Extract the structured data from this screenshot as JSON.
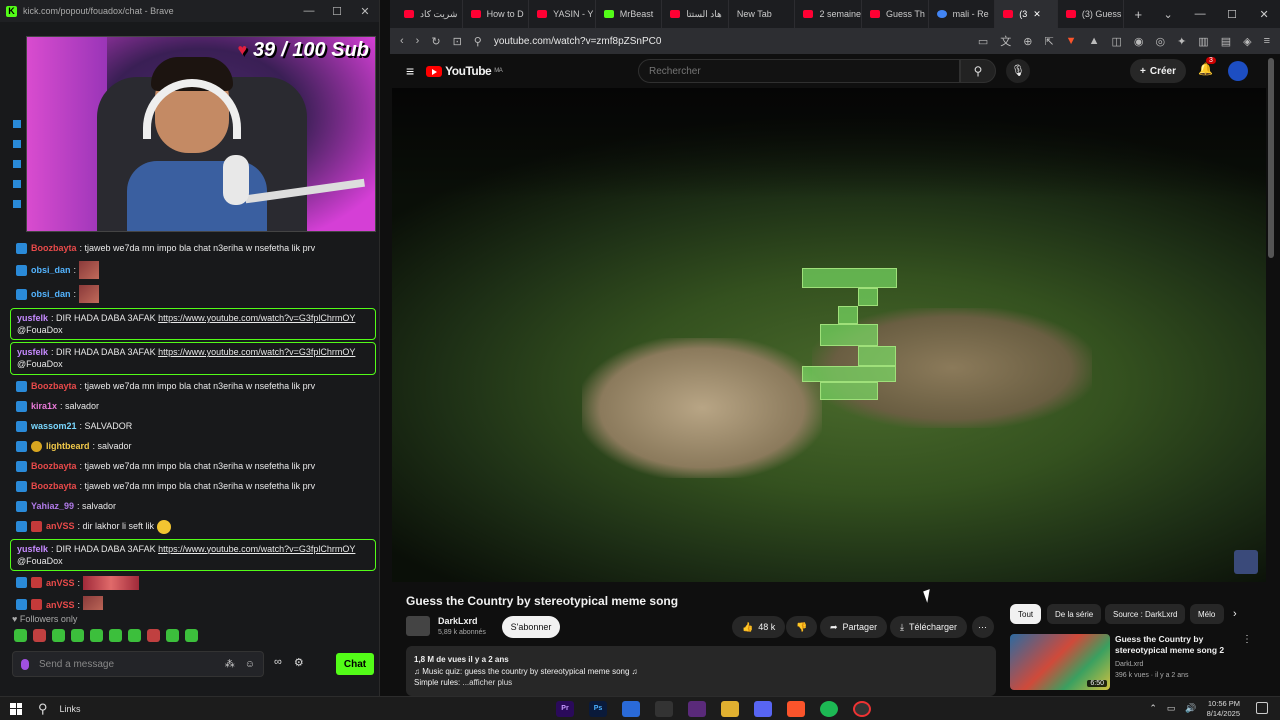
{
  "kick": {
    "window_title": "kick.com/popout/fouadox/chat - Brave",
    "sub_goal": {
      "current": "39",
      "goal": "/ 100 Sub"
    },
    "messages": [
      {
        "user": "Boozbayta",
        "user_color": "#e84a4a",
        "text": ": tjaweb we7da mn impo bla chat n3eriha w nsefetha lik prv",
        "kind": "plain"
      },
      {
        "user": "obsi_dan",
        "user_color": "#53b4ff",
        "text": ":",
        "kind": "thumb"
      },
      {
        "user": "obsi_dan",
        "user_color": "#53b4ff",
        "text": ":",
        "kind": "thumb"
      },
      {
        "user": "yusfelk",
        "user_color": "#c68aff",
        "text": ": DIR HADA DABA 3AFAK ",
        "link": "https://www.youtube.com/watch?v=G3fplChrmOY",
        "mention": "@FouaDox",
        "kind": "highlight"
      },
      {
        "user": "yusfelk",
        "user_color": "#c68aff",
        "text": ": DIR HADA DABA 3AFAK ",
        "link": "https://www.youtube.com/watch?v=G3fplChrmOY",
        "mention": "@FouaDox",
        "kind": "highlight"
      },
      {
        "user": "Boozbayta",
        "user_color": "#e84a4a",
        "text": ": tjaweb we7da mn impo bla chat n3eriha w nsefetha lik prv",
        "kind": "plain"
      },
      {
        "user": "kira1x",
        "user_color": "#e87ad8",
        "text": ": salvador",
        "kind": "plain"
      },
      {
        "user": "wassom21",
        "user_color": "#7ad8ff",
        "text": ": SALVADOR",
        "kind": "plain"
      },
      {
        "user": "lightbeard",
        "user_color": "#f0c84a",
        "text": ": salvador",
        "kind": "plain"
      },
      {
        "user": "Boozbayta",
        "user_color": "#e84a4a",
        "text": ": tjaweb we7da mn impo bla chat n3eriha w nsefetha lik prv",
        "kind": "plain"
      },
      {
        "user": "Boozbayta",
        "user_color": "#e84a4a",
        "text": ": tjaweb we7da mn impo bla chat n3eriha w nsefetha lik prv",
        "kind": "plain"
      },
      {
        "user": "Yahiaz_99",
        "user_color": "#b07ae8",
        "text": ": salvador",
        "kind": "plain"
      },
      {
        "user": "anVSS",
        "user_color": "#e84a4a",
        "text": ": dir lakhor li seft lik",
        "kind": "emoji"
      },
      {
        "user": "yusfelk",
        "user_color": "#c68aff",
        "text": ": DIR HADA DABA 3AFAK ",
        "link": "https://www.youtube.com/watch?v=G3fplChrmOY",
        "mention": "@FouaDox",
        "kind": "highlight"
      },
      {
        "user": "anVSS",
        "user_color": "#e84a4a",
        "text": ":",
        "kind": "wide"
      },
      {
        "user": "anVSS",
        "user_color": "#e84a4a",
        "text": ":",
        "kind": "thumb"
      }
    ],
    "followers_only": "Followers only",
    "input_placeholder": "Send a message",
    "send_label": "Chat"
  },
  "browser": {
    "tabs": [
      {
        "label": "شريت كاد",
        "icon": "youtube"
      },
      {
        "label": "How to D",
        "icon": "youtube"
      },
      {
        "label": "YASIN - Y",
        "icon": "youtube"
      },
      {
        "label": "MrBeast",
        "icon": "kick"
      },
      {
        "label": "هاد الستتا",
        "icon": "youtube"
      },
      {
        "label": "New Tab",
        "icon": "none"
      },
      {
        "label": "2 semaine",
        "icon": "youtube"
      },
      {
        "label": "Guess Th",
        "icon": "youtube"
      },
      {
        "label": "mali - Re",
        "icon": "google"
      },
      {
        "label": "(3",
        "icon": "youtube",
        "active": true
      },
      {
        "label": "(3) Guess",
        "icon": "youtube"
      }
    ],
    "url": "youtube.com/watch?v=zmf8pZSnPC0"
  },
  "youtube": {
    "logo_text": "YouTube",
    "logo_region": "MA",
    "search_placeholder": "Rechercher",
    "create_label": "Créer",
    "notif_count": "3",
    "video_title": "Guess the Country by stereotypical meme song",
    "channel_name": "DarkLxrd",
    "channel_subs": "5,89 k abonnés",
    "subscribe_label": "S'abonner",
    "likes": "48 k",
    "share_label": "Partager",
    "download_label": "Télécharger",
    "desc_meta": "1,8 M de vues  il y a 2 ans",
    "desc_line": "♫ Music quiz: guess the country by stereotypical meme song ♫",
    "desc_line2": "Simple rules:",
    "desc_more": "...afficher plus",
    "chips": [
      "Tout",
      "De la série",
      "Source : DarkLxrd",
      "Mélo"
    ],
    "rec": {
      "title": "Guess the Country by stereotypical meme song 2",
      "channel": "DarkLxrd",
      "stats": "396 k vues · il y a 2 ans",
      "duration": "6:50"
    }
  },
  "taskbar": {
    "links_label": "Links",
    "time": "10:56 PM",
    "date": "8/14/2025"
  },
  "colors": {
    "kick_green": "#53fc18",
    "yt_red": "#ff0000",
    "brave_orange": "#fb542b"
  }
}
